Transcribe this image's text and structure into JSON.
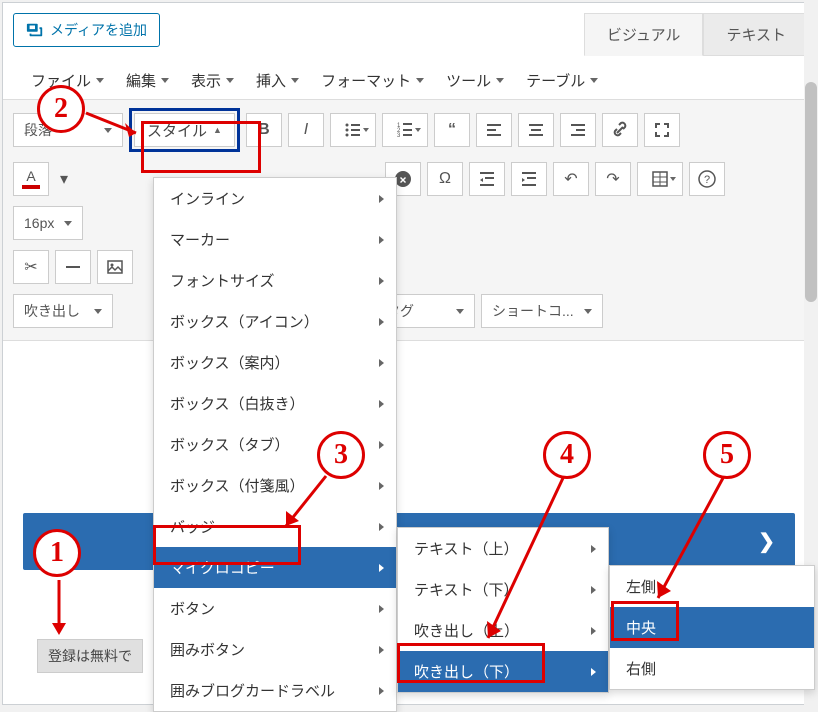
{
  "media_button": "メディアを追加",
  "tabs": {
    "visual": "ビジュアル",
    "text": "テキスト"
  },
  "menubar": [
    "ファイル",
    "編集",
    "表示",
    "挿入",
    "フォーマット",
    "ツール",
    "テーブル"
  ],
  "toolbar": {
    "paragraph_select": "段落",
    "style_button": "スタイル",
    "font_size": "16px",
    "speech_select": "吹き出し",
    "tag_select": "タグ",
    "shortcode_select": "ショートコ..."
  },
  "style_menu": {
    "items": [
      "インライン",
      "マーカー",
      "フォントサイズ",
      "ボックス（アイコン）",
      "ボックス（案内）",
      "ボックス（白抜き）",
      "ボックス（タブ）",
      "ボックス（付箋風）",
      "バッジ",
      "マイクロコピー",
      "ボタン",
      "囲みボタン",
      "囲みブログカードラベル"
    ]
  },
  "microcopy_menu": {
    "items": [
      "テキスト（上）",
      "テキスト（下）",
      "吹き出し（上）",
      "吹き出し（下）"
    ]
  },
  "position_menu": {
    "items": [
      "左側",
      "中央",
      "右側"
    ]
  },
  "content": {
    "registration_text": "登録は無料で"
  },
  "annotations": [
    "1",
    "2",
    "3",
    "4",
    "5"
  ]
}
